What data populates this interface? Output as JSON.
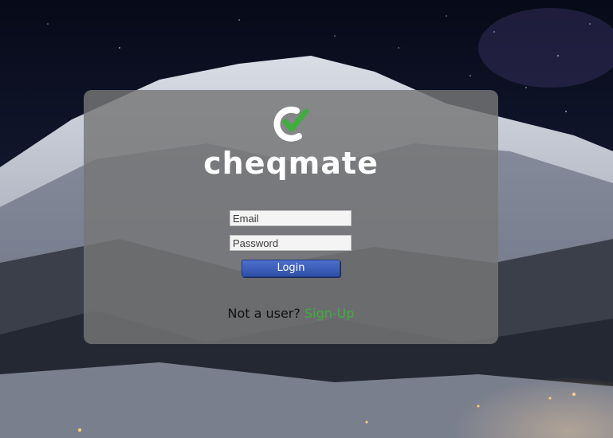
{
  "brand": {
    "name": "cheqmate",
    "check_color": "#3fae3f"
  },
  "login_form": {
    "email_placeholder": "Email",
    "password_placeholder": "Password",
    "login_label": "Login"
  },
  "signup": {
    "prompt": "Not a user?",
    "link_label": "Sign-Up",
    "link_color": "#3fae3f"
  }
}
